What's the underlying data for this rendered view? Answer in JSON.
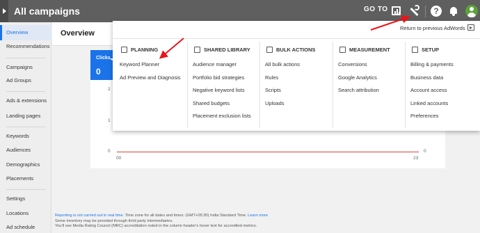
{
  "topbar": {
    "title": "All campaigns",
    "goto_label": "GO TO",
    "icons": [
      "reports-icon",
      "tools-icon",
      "help-icon",
      "notifications-icon",
      "avatar"
    ]
  },
  "sidenav": {
    "items": [
      {
        "label": "Overview",
        "active": true
      },
      {
        "label": "Recommendations"
      },
      {
        "label": "Campaigns"
      },
      {
        "label": "Ad Groups"
      },
      {
        "label": "Ads & extensions"
      },
      {
        "label": "Landing pages"
      },
      {
        "label": "Keywords"
      },
      {
        "label": "Audiences"
      },
      {
        "label": "Demographics"
      },
      {
        "label": "Placements"
      },
      {
        "label": "Settings"
      },
      {
        "label": "Locations"
      },
      {
        "label": "Ad schedule"
      }
    ]
  },
  "main": {
    "title": "Overview",
    "metric_label": "Clicks",
    "metric_value": "0",
    "y_ticks_left": [
      "2",
      "1",
      "0"
    ],
    "y_tick_right": "0",
    "x_tick_start": "00",
    "x_tick_end": "23"
  },
  "footer": {
    "link1": "Reporting is not carried out in real time.",
    "text1": " Time zone for all dates and times: (GMT+05:30) India Standard Time. ",
    "link2": "Learn more",
    "line2": "Some inventory may be provided through third party intermediaries.",
    "line3": "You'll see Media Rating Council (MRC) accreditation noted in the column header's hover text for accredited metrics."
  },
  "tools_panel": {
    "return_label": "Return to previous AdWords",
    "columns": [
      {
        "heading": "PLANNING",
        "icon": "planning-icon",
        "items": [
          "Keyword Planner",
          "Ad Preview and Diagnosis"
        ]
      },
      {
        "heading": "SHARED LIBRARY",
        "icon": "shared-library-icon",
        "items": [
          "Audience manager",
          "Portfolio bid strategies",
          "Negative keyword lists",
          "Shared budgets",
          "Placement exclusion lists"
        ]
      },
      {
        "heading": "BULK ACTIONS",
        "icon": "bulk-actions-icon",
        "items": [
          "All bulk actions",
          "Rules",
          "Scripts",
          "Uploads"
        ]
      },
      {
        "heading": "MEASUREMENT",
        "icon": "measurement-icon",
        "items": [
          "Conversions",
          "Google Analytics",
          "Search attribution"
        ]
      },
      {
        "heading": "SETUP",
        "icon": "setup-icon",
        "items": [
          "Billing & payments",
          "Business data",
          "Account access",
          "Linked accounts",
          "Preferences"
        ]
      }
    ]
  },
  "colors": {
    "accent": "#1a73e8",
    "topbar": "#5f5f5f",
    "annotation": "#e8161b",
    "chart_line": "#db4437"
  }
}
